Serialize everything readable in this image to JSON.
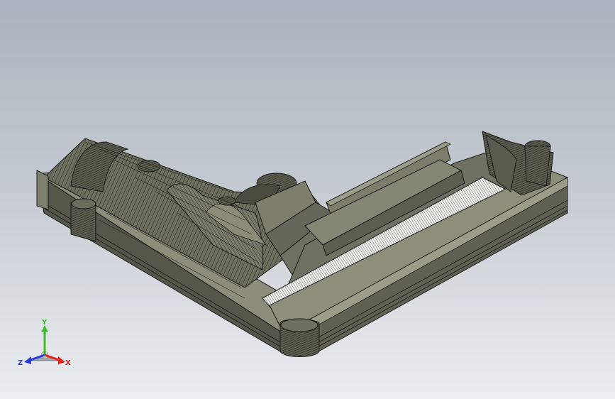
{
  "viewport": {
    "background_top": "#aab3bd",
    "background_bottom": "#eceef1"
  },
  "model": {
    "name": "l-shaped-part-isometric",
    "shade_color": "#75786a",
    "edge_color": "#1a1a1a"
  },
  "triad": {
    "x_label": "X",
    "y_label": "Y",
    "z_label": "Z",
    "x_color": "#e8201a",
    "y_color": "#3cbf2a",
    "z_color": "#2a3ce0"
  }
}
